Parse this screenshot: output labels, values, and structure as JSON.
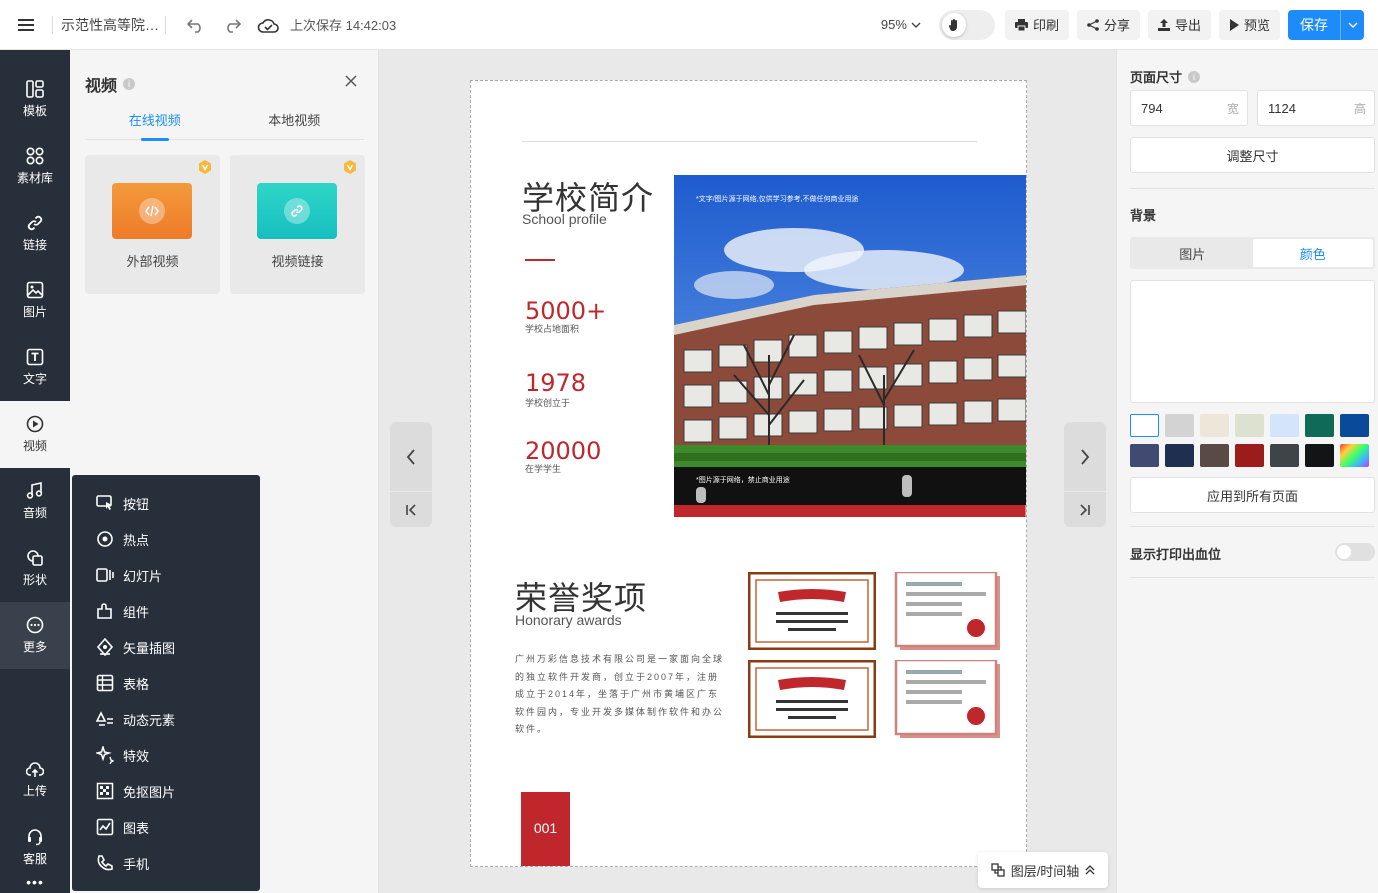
{
  "topbar": {
    "doc_title": "示范性高等院校宣传册",
    "save_status": "上次保存 14:42:03",
    "zoom": "95%",
    "buttons": {
      "print": "印刷",
      "share": "分享",
      "export": "导出",
      "preview": "预览",
      "save": "保存"
    }
  },
  "rail": {
    "items": [
      {
        "label": "模板",
        "icon": "template-icon"
      },
      {
        "label": "素材库",
        "icon": "material-library-icon"
      },
      {
        "label": "链接",
        "icon": "link-icon"
      },
      {
        "label": "图片",
        "icon": "image-icon"
      },
      {
        "label": "文字",
        "icon": "text-icon"
      },
      {
        "label": "视频",
        "icon": "video-icon"
      },
      {
        "label": "音频",
        "icon": "audio-icon"
      },
      {
        "label": "形状",
        "icon": "shape-icon"
      },
      {
        "label": "更多",
        "icon": "more-icon"
      },
      {
        "label": "上传",
        "icon": "upload-icon"
      },
      {
        "label": "客服",
        "icon": "customer-service-icon"
      }
    ],
    "dots": "•••"
  },
  "video_panel": {
    "title": "视频",
    "info": "i",
    "tabs": [
      "在线视频",
      "本地视频"
    ],
    "cards": [
      {
        "label": "外部视频",
        "color_from": "#f39a3c",
        "color_to": "#ee7b28"
      },
      {
        "label": "视频链接",
        "color_from": "#2fd6c8",
        "color_to": "#16bfc0"
      }
    ]
  },
  "more_menu": {
    "items": [
      {
        "label": "按钮",
        "icon": "button-icon"
      },
      {
        "label": "热点",
        "icon": "hotspot-icon"
      },
      {
        "label": "幻灯片",
        "icon": "slideshow-icon"
      },
      {
        "label": "组件",
        "icon": "component-icon"
      },
      {
        "label": "矢量插图",
        "icon": "vector-illustration-icon"
      },
      {
        "label": "表格",
        "icon": "table-icon"
      },
      {
        "label": "动态元素",
        "icon": "dynamic-element-icon"
      },
      {
        "label": "特效",
        "icon": "effects-icon"
      },
      {
        "label": "免抠图片",
        "icon": "cutout-image-icon"
      },
      {
        "label": "图表",
        "icon": "chart-icon"
      },
      {
        "label": "手机",
        "icon": "phone-icon"
      }
    ]
  },
  "page": {
    "section1_cn": "学校简介",
    "section1_en": "School profile",
    "stats": [
      {
        "value": "5000+",
        "label": "学校占地面积"
      },
      {
        "value": "1978",
        "label": "学校创立于"
      },
      {
        "value": "20000",
        "label": "在学学生"
      }
    ],
    "photo_note_top": "*文字/图片源于网络,仅供学习参考,不做任何商业用途",
    "photo_note_bottom": "*图片源于网络，禁止商业用途",
    "section2_cn": "荣誉奖项",
    "section2_en": "Honorary awards",
    "paragraph": "广州万彩信息技术有限公司是一家面向全球的独立软件开发商，创立于2007年，注册成立于2014年，坐落于广州市黄埔区广东软件园内，专业开发多媒体制作软件和办公软件。",
    "page_number": "001",
    "accent_color": "#c0272d"
  },
  "layer_button": "图层/时间轴",
  "right_panel": {
    "page_size_title": "页面尺寸",
    "width": "794",
    "width_unit": "宽",
    "height": "1124",
    "height_unit": "高",
    "resize_button": "调整尺寸",
    "background_title": "背景",
    "bg_tabs": [
      "图片",
      "颜色"
    ],
    "swatches": [
      "#ffffff",
      "#d3d3d3",
      "#ede6d9",
      "#dde1cf",
      "#d4e4fa",
      "#0f6b57",
      "#0a4a9a",
      "#414a70",
      "#1e2f4f",
      "#5a4a46",
      "#9c1c1c",
      "#3f4448",
      "#121416",
      "rainbow"
    ],
    "apply_all_button": "应用到所有页面",
    "bleed_title": "显示打印出血位",
    "bleed_on": false
  }
}
